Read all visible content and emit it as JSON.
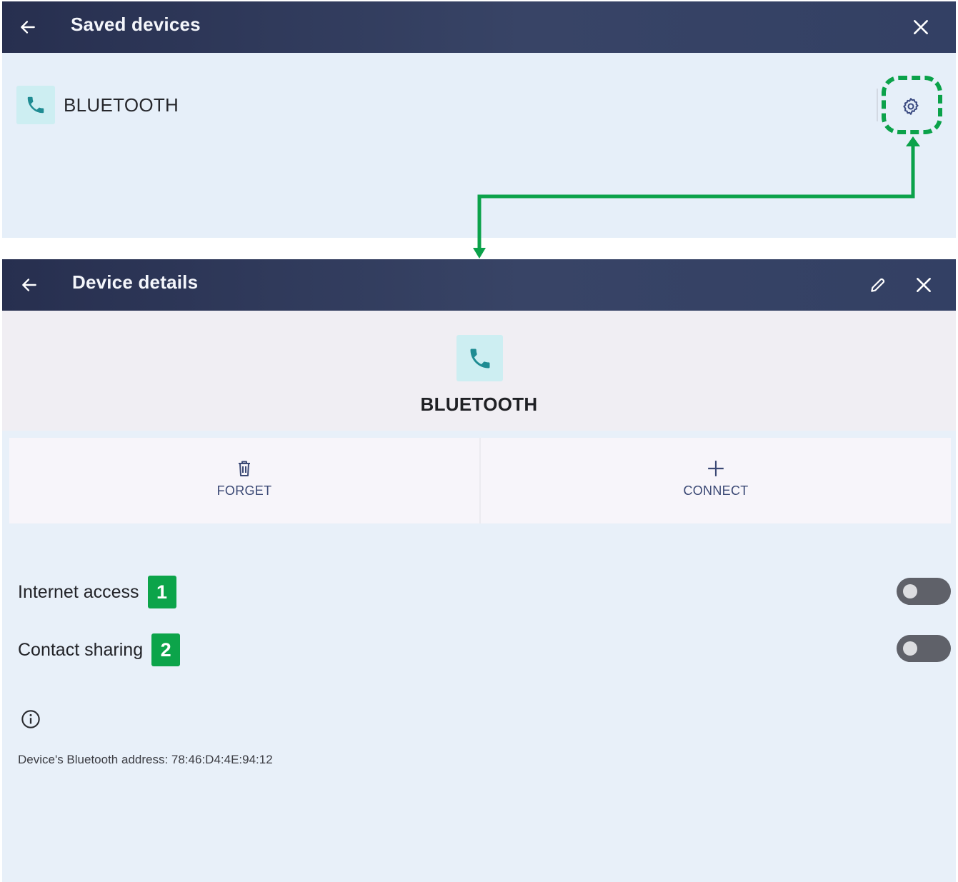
{
  "saved_devices": {
    "title": "Saved devices",
    "device": {
      "name": "BLUETOOTH",
      "icon": "phone-icon"
    }
  },
  "device_details": {
    "title": "Device details",
    "device_name": "BLUETOOTH",
    "actions": [
      {
        "label": "FORGET",
        "icon": "trash-icon"
      },
      {
        "label": "CONNECT",
        "icon": "plus-icon"
      }
    ],
    "settings": [
      {
        "label": "Internet access",
        "badge": "1",
        "enabled": false
      },
      {
        "label": "Contact sharing",
        "badge": "2",
        "enabled": false
      }
    ],
    "address_text": "Device's Bluetooth address: 78:46:D4:4E:94:12"
  },
  "colors": {
    "header": "#2f3a5c",
    "highlight": "#0ba24a",
    "phone_tile": "#cdeef2",
    "phone_icon": "#1f8c93"
  }
}
